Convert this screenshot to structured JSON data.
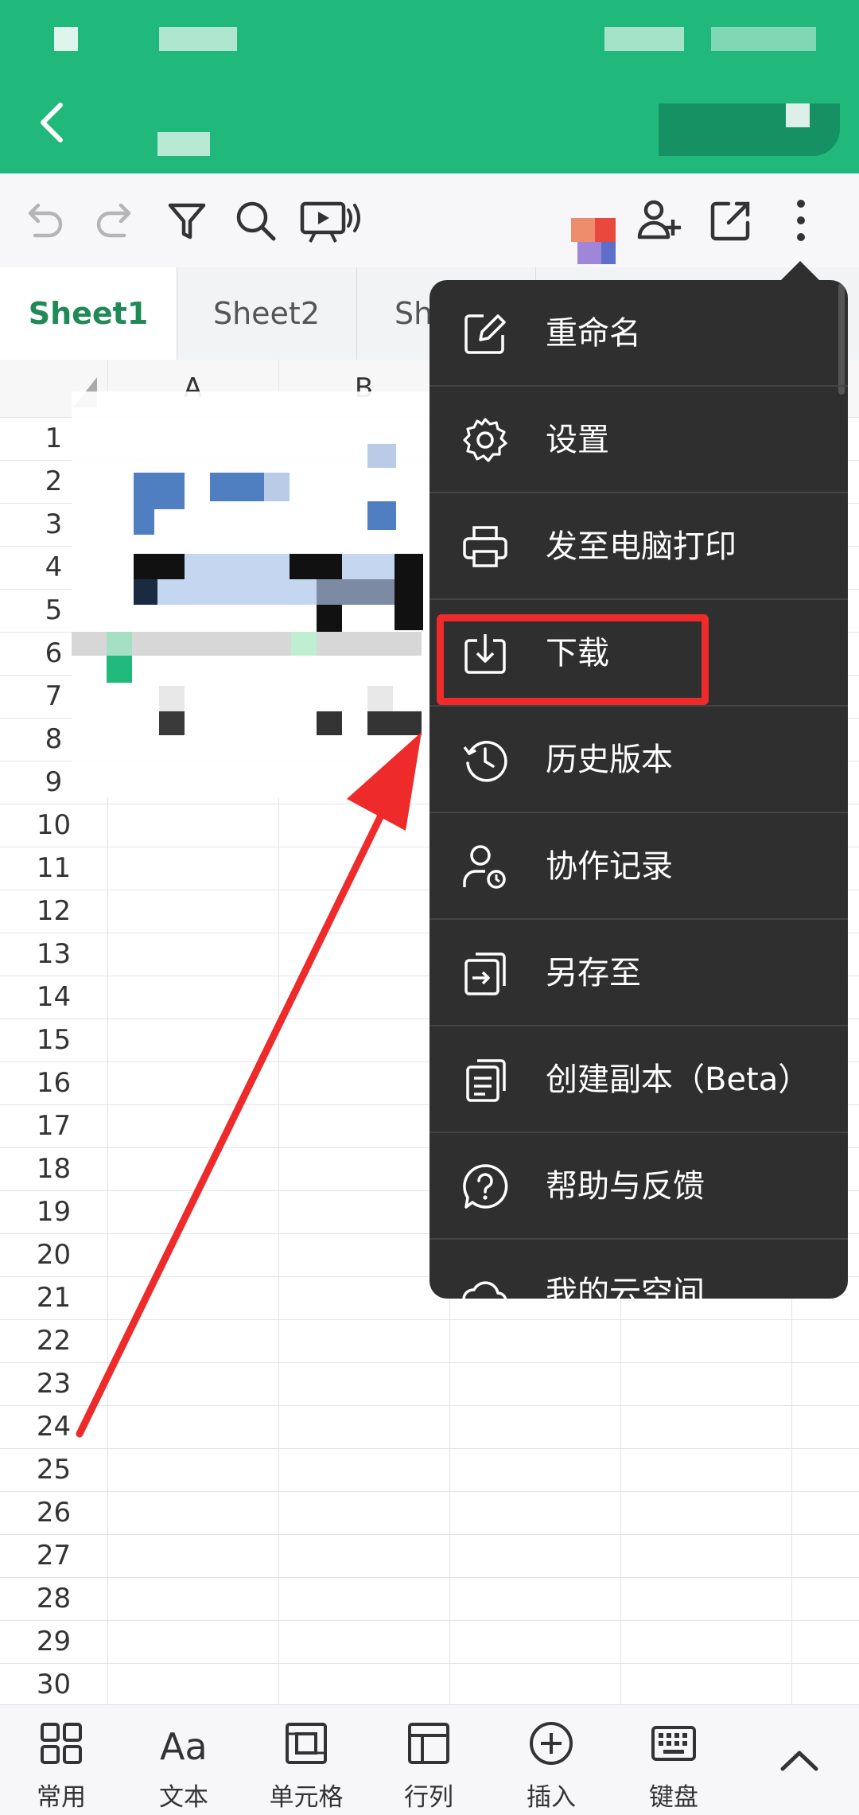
{
  "toolbar": {
    "icons": [
      "undo-icon",
      "redo-icon",
      "filter-icon",
      "search-icon",
      "presentation-icon",
      "avatar",
      "add-collaborator-icon",
      "share-icon",
      "more-icon"
    ]
  },
  "tabs": [
    {
      "label": "Sheet1",
      "active": true
    },
    {
      "label": "Sheet2",
      "active": false
    },
    {
      "label": "Sh",
      "active": false
    }
  ],
  "grid": {
    "columns": [
      "A",
      "B"
    ],
    "rows": [
      "1",
      "2",
      "3",
      "4",
      "5",
      "6",
      "7",
      "8",
      "9",
      "10",
      "11",
      "12",
      "13",
      "14",
      "15",
      "16",
      "17",
      "18",
      "19",
      "20",
      "21",
      "22",
      "23",
      "24",
      "25",
      "26",
      "27",
      "28",
      "29",
      "30"
    ]
  },
  "menu": {
    "items": [
      {
        "label": "重命名",
        "icon": "rename-icon"
      },
      {
        "label": "设置",
        "icon": "gear-icon"
      },
      {
        "label": "发至电脑打印",
        "icon": "printer-icon"
      },
      {
        "label": "下载",
        "icon": "download-icon",
        "highlighted": true
      },
      {
        "label": "历史版本",
        "icon": "history-icon"
      },
      {
        "label": "协作记录",
        "icon": "collaborator-record-icon"
      },
      {
        "label": "另存至",
        "icon": "save-to-icon"
      },
      {
        "label": "创建副本（Beta）",
        "icon": "copy-document-icon"
      },
      {
        "label": "帮助与反馈",
        "icon": "help-icon"
      },
      {
        "label": "我的云空间",
        "icon": "cloud-icon"
      }
    ]
  },
  "bottombar": {
    "items": [
      {
        "label": "常用",
        "icon": "grid-icon"
      },
      {
        "label": "文本",
        "icon": "text-icon"
      },
      {
        "label": "单元格",
        "icon": "cell-icon"
      },
      {
        "label": "行列",
        "icon": "row-column-icon"
      },
      {
        "label": "插入",
        "icon": "plus-circle-icon"
      },
      {
        "label": "键盘",
        "icon": "keyboard-icon"
      }
    ]
  },
  "colors": {
    "header_green": "#20b97b",
    "menu_bg": "#2f2f2f",
    "annotation_red": "#ee2a2a",
    "active_tab": "#1f8a55"
  }
}
